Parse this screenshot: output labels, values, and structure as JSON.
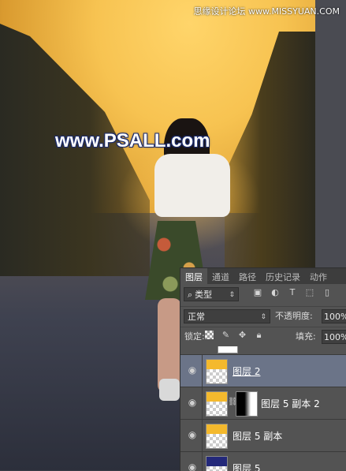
{
  "watermark": {
    "site_text": "www.PSALL.com",
    "top_credit": "思缘设计论坛 www.MISSYUAN.COM"
  },
  "colors": {
    "sky": "#f7c351",
    "panel_bg": "#535353",
    "selected_layer": "#6b7488",
    "yellow_thumb": "#f4b92d",
    "navy_thumb": "#23287a"
  },
  "panel": {
    "tabs": [
      "图层",
      "通道",
      "路径",
      "历史记录",
      "动作"
    ],
    "active_tab": "图层",
    "filter": {
      "icon": "search-icon",
      "label": "类型"
    },
    "filter_icons": [
      "image-filter-icon",
      "adjustment-filter-icon",
      "type-filter-icon",
      "shape-filter-icon",
      "smart-object-filter-icon"
    ],
    "blend_mode": "正常",
    "opacity_label": "不透明度:",
    "opacity_value": "100%",
    "lock_label": "锁定:",
    "lock_icons": [
      "lock-transparent-icon",
      "lock-paint-icon",
      "lock-move-icon",
      "lock-all-icon"
    ],
    "fill_label": "填充:",
    "fill_value": "100%"
  },
  "layers": [
    {
      "name": "图层 2",
      "selected": true,
      "thumb": "yellow",
      "visible": true
    },
    {
      "name": "图层 5 副本 2",
      "selected": false,
      "thumb": "yellow",
      "mask": true,
      "visible": true
    },
    {
      "name": "图层 5 副本",
      "selected": false,
      "thumb": "yellow",
      "visible": true
    },
    {
      "name": "图层 5",
      "selected": false,
      "thumb": "navy",
      "visible": true
    }
  ]
}
